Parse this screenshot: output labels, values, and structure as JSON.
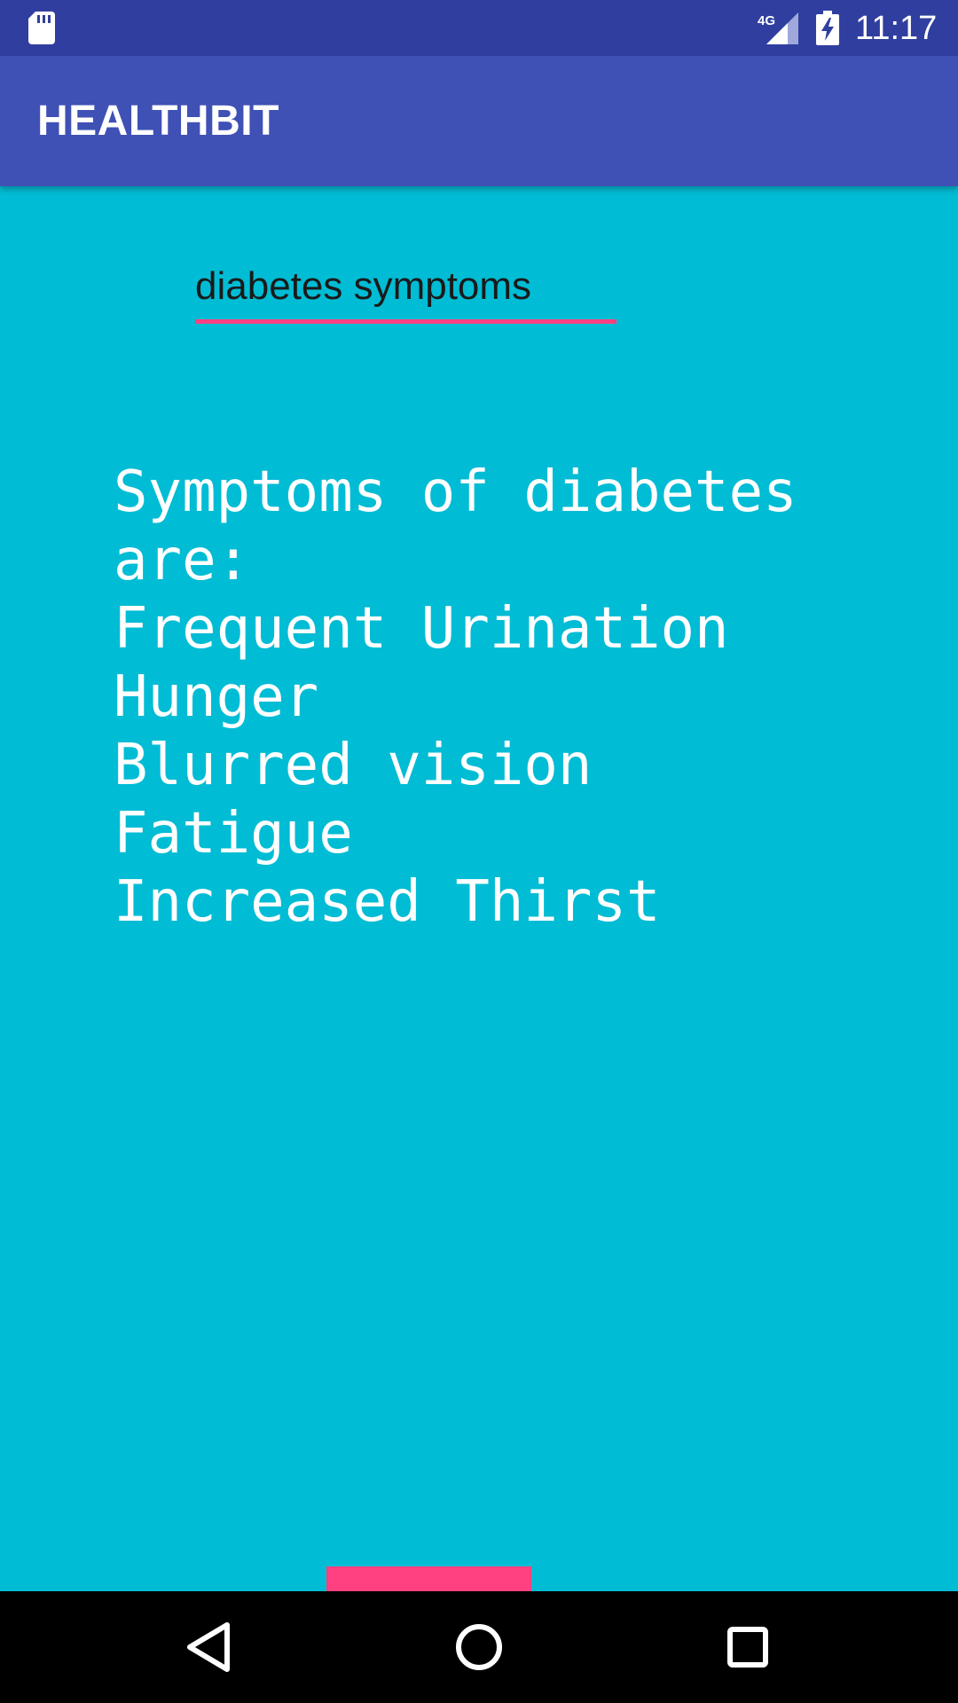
{
  "status_bar": {
    "time": "11:17",
    "network": "4G",
    "icons": [
      "sd-card-icon",
      "signal-icon",
      "battery-charging-icon"
    ]
  },
  "app_bar": {
    "title": "HEALTHBIT"
  },
  "search": {
    "value": "diabetes symptoms"
  },
  "result": {
    "text": "Symptoms of diabetes\nare:\nFrequent Urination\nHunger\nBlurred vision\nFatigue\nIncreased Thirst"
  },
  "nav_bar": {
    "icons": [
      "back-icon",
      "home-icon",
      "recents-icon"
    ]
  },
  "colors": {
    "status_bar": "#303f9f",
    "app_bar": "#3f51b5",
    "background": "#00bcd4",
    "accent": "#ff4081",
    "nav_bar": "#000000"
  }
}
